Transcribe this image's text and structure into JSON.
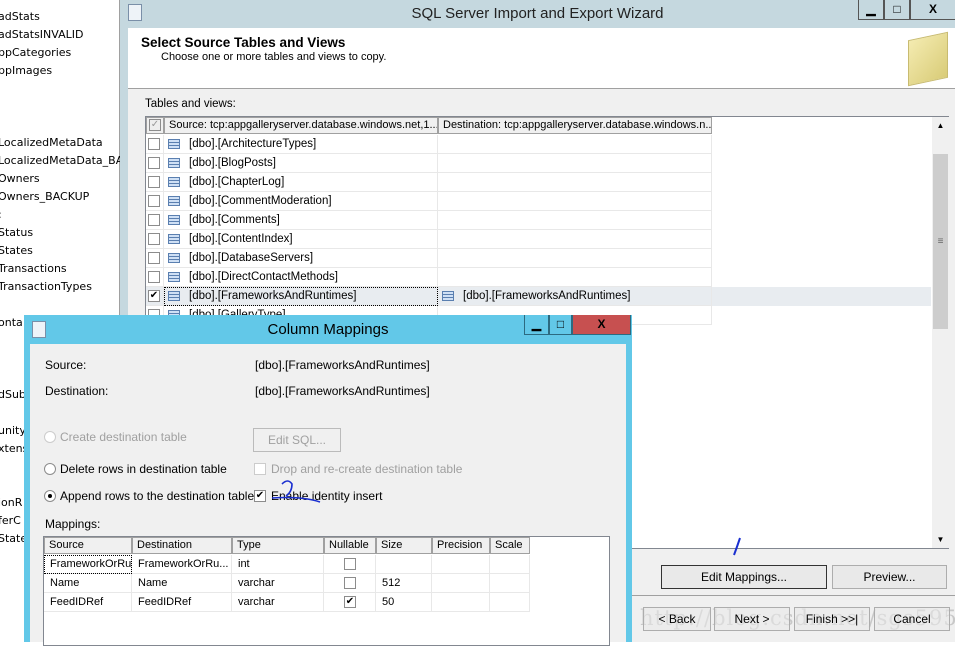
{
  "background_list": [
    "adStats",
    "adStatsINVALID",
    "ppCategories",
    "ppImages",
    "LocalizedMetaData",
    "LocalizedMetaData_BA",
    "Owners",
    "Owners_BACKUP",
    ":",
    "Status",
    "States",
    "Transactions",
    "TransactionTypes",
    "onta",
    "dSub",
    "unity",
    "xtens",
    "ionR",
    "ferC",
    "State"
  ],
  "wizard": {
    "title": "SQL Server Import and Export Wizard",
    "header_title": "Select Source Tables and Views",
    "header_subtitle": "Choose one or more tables and views to copy.",
    "tables_label": "Tables and views:",
    "columns": {
      "source": "Source: tcp:appgalleryserver.database.windows.net,1...",
      "destination": "Destination: tcp:appgalleryserver.database.windows.n..."
    },
    "rows": [
      {
        "source": "[dbo].[ArchitectureTypes]",
        "destination": "",
        "checked": false
      },
      {
        "source": "[dbo].[BlogPosts]",
        "destination": "",
        "checked": false
      },
      {
        "source": "[dbo].[ChapterLog]",
        "destination": "",
        "checked": false
      },
      {
        "source": "[dbo].[CommentModeration]",
        "destination": "",
        "checked": false
      },
      {
        "source": "[dbo].[Comments]",
        "destination": "",
        "checked": false
      },
      {
        "source": "[dbo].[ContentIndex]",
        "destination": "",
        "checked": false
      },
      {
        "source": "[dbo].[DatabaseServers]",
        "destination": "",
        "checked": false
      },
      {
        "source": "[dbo].[DirectContactMethods]",
        "destination": "",
        "checked": false
      },
      {
        "source": "[dbo].[FrameworksAndRuntimes]",
        "destination": "[dbo].[FrameworksAndRuntimes]",
        "checked": true
      },
      {
        "source": "[dbo].[GalleryType]",
        "destination": "",
        "checked": false
      }
    ],
    "edit_mappings": "Edit Mappings...",
    "preview": "Preview...",
    "back": "< Back",
    "next": "Next >",
    "finish": "Finish >>|",
    "cancel": "Cancel"
  },
  "dialog": {
    "title": "Column Mappings",
    "source_label": "Source:",
    "source_value": "[dbo].[FrameworksAndRuntimes]",
    "destination_label": "Destination:",
    "destination_value": "[dbo].[FrameworksAndRuntimes]",
    "create_table": "Create destination table",
    "edit_sql": "Edit SQL...",
    "delete_rows": "Delete rows in destination table",
    "drop_recreate": "Drop and re-create destination table",
    "append_rows": "Append rows to the destination table",
    "enable_identity": "Enable identity insert",
    "enable_identity_checked": true,
    "selected_option": "append",
    "mappings_label": "Mappings:",
    "headers": [
      "Source",
      "Destination",
      "Type",
      "Nullable",
      "Size",
      "Precision",
      "Scale"
    ],
    "mappings": [
      {
        "source": "FrameworkOrRu...",
        "destination": "FrameworkOrRu...",
        "type": "int",
        "nullable": false,
        "size": "",
        "precision": "",
        "scale": ""
      },
      {
        "source": "Name",
        "destination": "Name",
        "type": "varchar",
        "nullable": false,
        "size": "512",
        "precision": "",
        "scale": ""
      },
      {
        "source": "FeedIDRef",
        "destination": "FeedIDRef",
        "type": "varchar",
        "nullable": true,
        "size": "50",
        "precision": "",
        "scale": ""
      }
    ]
  },
  "watermark": "http://blog.csdn.net/sgs595595",
  "colors": {
    "dialog_frame": "#62c8e8",
    "close_button": "#c75050",
    "wizard_frame": "#c5d8df",
    "annotation_ink": "#1a2fd0"
  }
}
